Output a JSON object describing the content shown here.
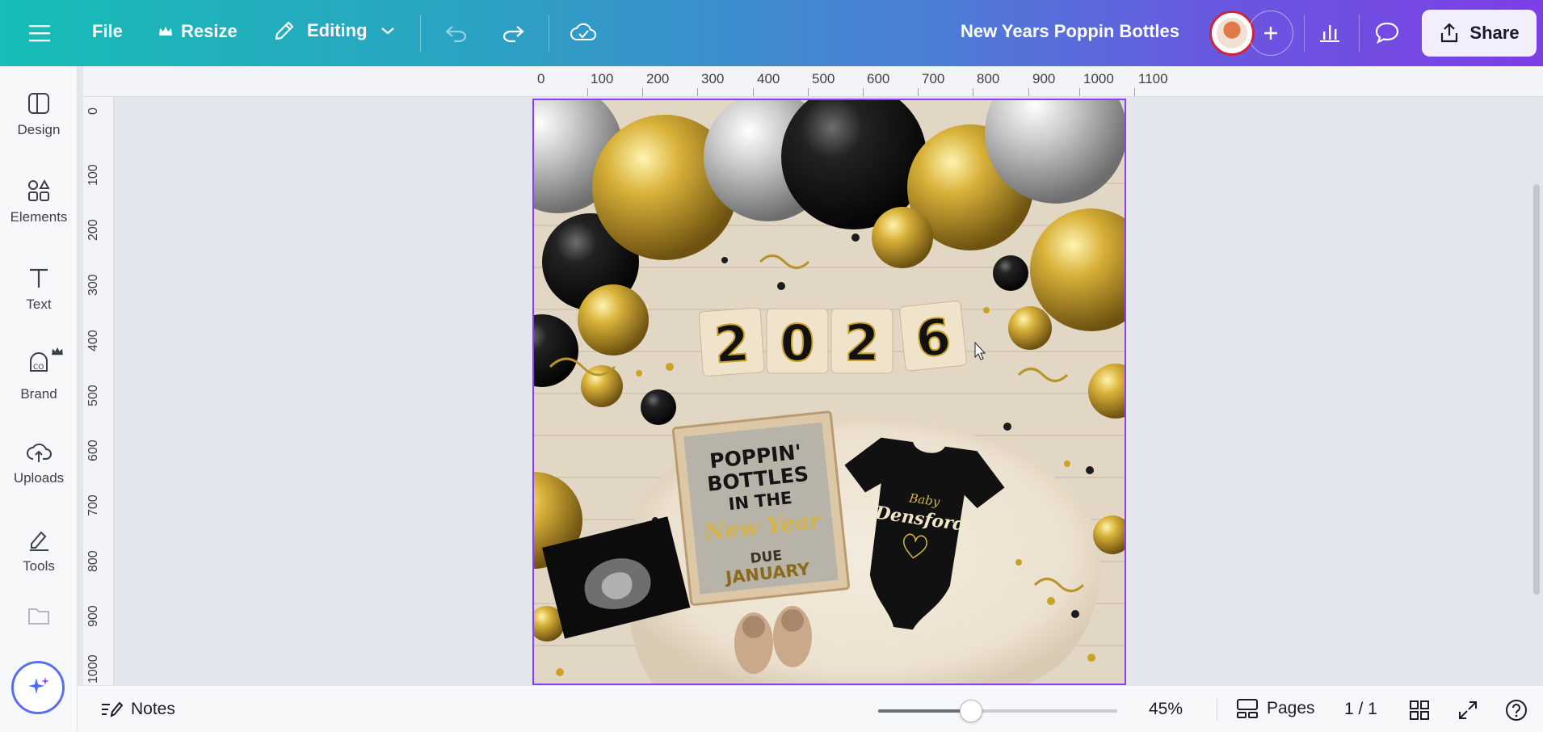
{
  "topbar": {
    "file_label": "File",
    "resize_label": "Resize",
    "editing_label": "Editing",
    "design_title": "New Years Poppin Bottles",
    "share_label": "Share",
    "icons": [
      "menu-icon",
      "crown-icon",
      "pencil-icon",
      "chevron-down-icon",
      "undo-icon",
      "redo-icon",
      "cloud-check-icon",
      "plus-icon",
      "bar-chart-icon",
      "comment-icon",
      "share-icon"
    ]
  },
  "sidebar": {
    "items": [
      {
        "label": "Design",
        "icon": "layout-icon"
      },
      {
        "label": "Elements",
        "icon": "shapes-icon"
      },
      {
        "label": "Text",
        "icon": "text-icon"
      },
      {
        "label": "Brand",
        "icon": "brand-icon"
      },
      {
        "label": "Uploads",
        "icon": "cloud-upload-icon"
      },
      {
        "label": "Tools",
        "icon": "tools-icon"
      }
    ]
  },
  "ruler": {
    "top_ticks": [
      "0",
      "100",
      "200",
      "300",
      "400",
      "500",
      "600",
      "700",
      "800",
      "900",
      "1000",
      "1100"
    ],
    "left_ticks": [
      "0",
      "100",
      "200",
      "300",
      "400",
      "500",
      "600",
      "700",
      "800",
      "900",
      "1000"
    ]
  },
  "design": {
    "year_blocks": [
      "2",
      "0",
      "2",
      "6"
    ],
    "letterboard_line1": "POPPIN'",
    "letterboard_line2": "BOTTLES",
    "letterboard_line3": "IN THE",
    "letterboard_line4": "New Year",
    "letterboard_due": "DUE",
    "letterboard_month": "JANUARY",
    "onesie_small": "Baby",
    "onesie_name": "Densford"
  },
  "bottombar": {
    "notes_label": "Notes",
    "zoom_value": 45,
    "zoom_label": "45%",
    "pages_label": "Pages",
    "page_counter": "1 / 1"
  },
  "colors": {
    "accent": "#8b3dff",
    "gold": "#c9a227",
    "black_balloon": "#1a1a1a",
    "silver": "#c8c8c8"
  }
}
